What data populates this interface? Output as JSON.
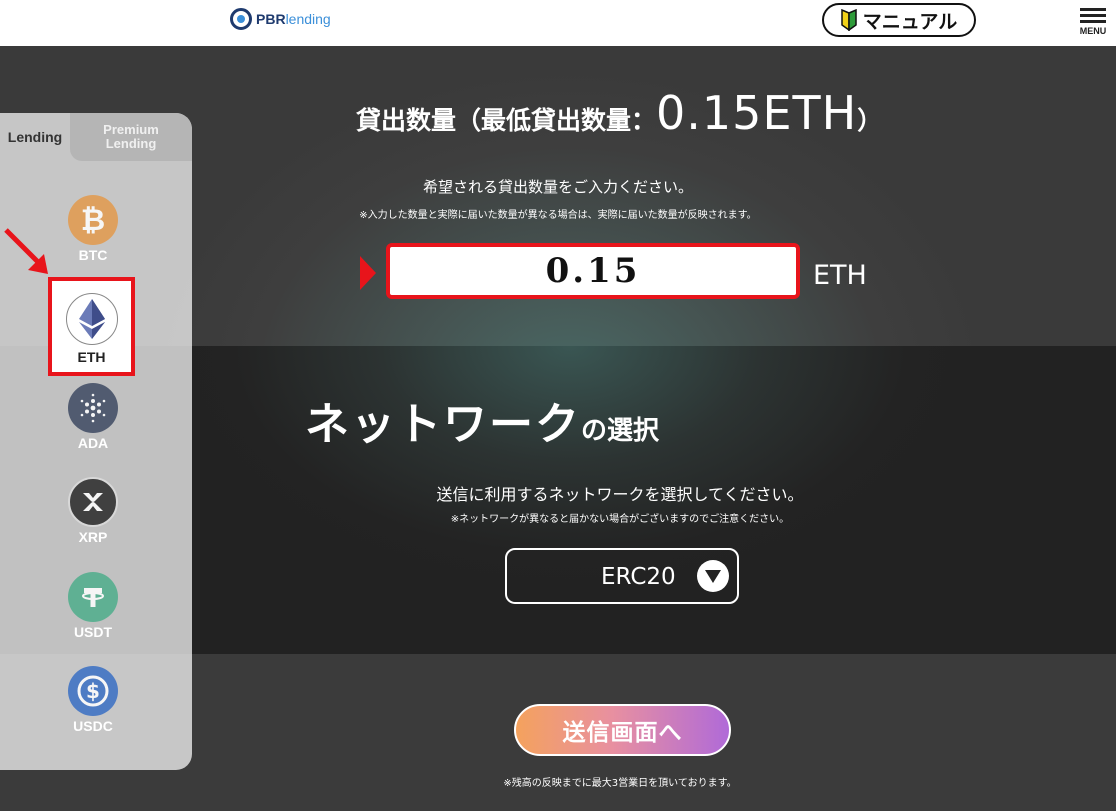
{
  "header": {
    "logo_text_1": "PBR",
    "logo_text_2": "lending",
    "manual_label": "マニュアル",
    "menu_label": "MENU"
  },
  "sidebar": {
    "tabs": [
      {
        "label": "Lending",
        "active": true
      },
      {
        "label": "Premium\nLending",
        "active": false
      }
    ],
    "coins": [
      {
        "symbol": "BTC",
        "icon": "bitcoin-icon",
        "color": "#e39a4c"
      },
      {
        "symbol": "ETH",
        "icon": "ethereum-icon",
        "color": "#ffffff",
        "selected": true
      },
      {
        "symbol": "ADA",
        "icon": "cardano-icon",
        "color": "#3e4a63"
      },
      {
        "symbol": "XRP",
        "icon": "xrp-icon",
        "color": "#2a2a2a"
      },
      {
        "symbol": "USDT",
        "icon": "tether-icon",
        "color": "#4fae8c"
      },
      {
        "symbol": "USDC",
        "icon": "usdc-icon",
        "color": "#3a6fc4"
      }
    ]
  },
  "lending": {
    "title_prefix": "貸出数量（最低貸出数量：",
    "min_amount": "0.15ETH",
    "title_suffix": "）",
    "instruction": "希望される貸出数量をご入力ください。",
    "note": "※入力した数量と実際に届いた数量が異なる場合は、実際に届いた数量が反映されます。",
    "amount_value": "0.15",
    "unit": "ETH"
  },
  "network": {
    "title_main": "ネットワーク",
    "title_sub": "の選択",
    "instruction": "送信に利用するネットワークを選択してください。",
    "note": "※ネットワークが異なると届かない場合がございますのでご注意ください。",
    "selected": "ERC20"
  },
  "submit": {
    "label": "送信画面へ",
    "note": "※残高の反映までに最大3営業日を頂いております。"
  },
  "colors": {
    "accent_red": "#e8141b",
    "button_gradient_start": "#f4a25d",
    "button_gradient_end": "#b06ad8"
  }
}
